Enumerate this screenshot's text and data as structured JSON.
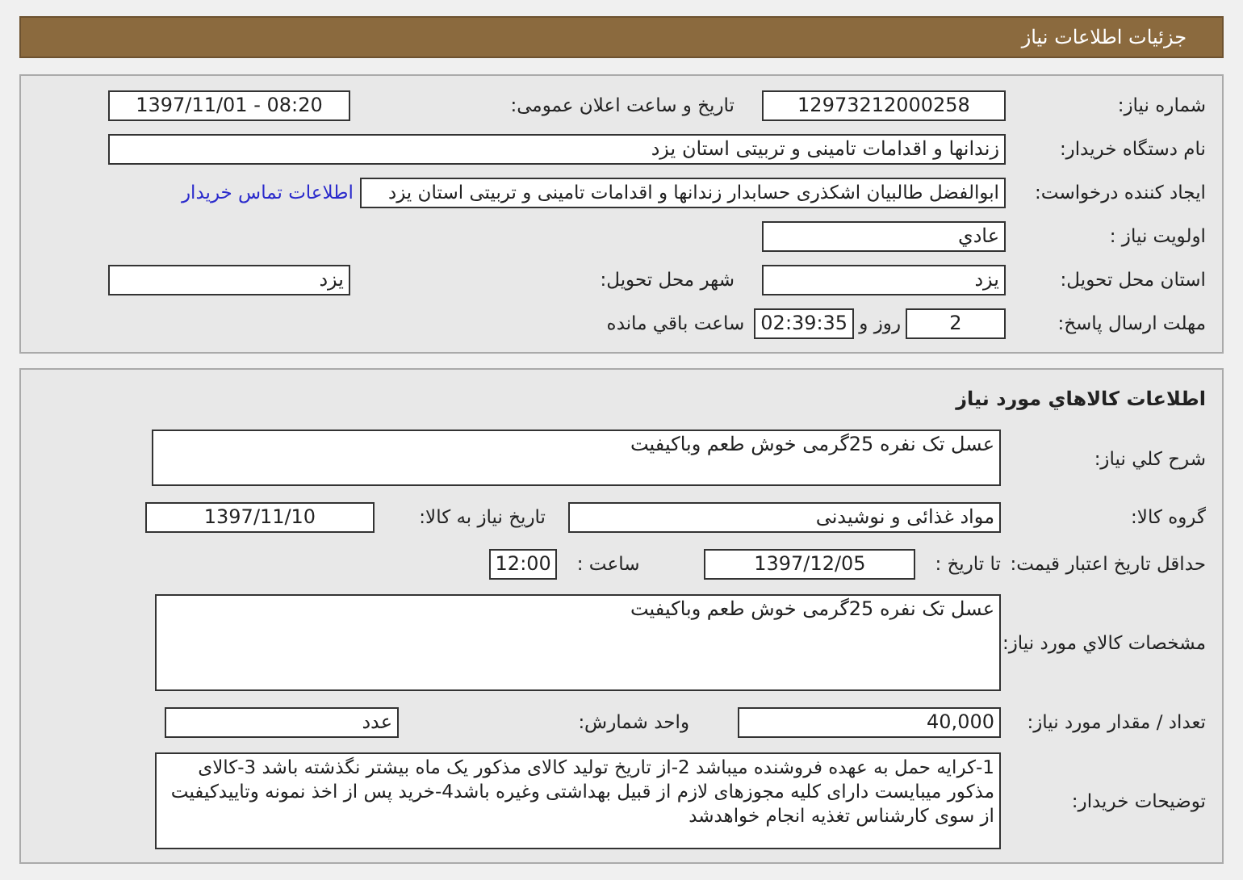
{
  "header": {
    "title": "جزئیات اطلاعات نیاز"
  },
  "need_info": {
    "need_number": {
      "label": "شماره نیاز:",
      "value": "12973212000258"
    },
    "announce": {
      "label": "تاریخ و ساعت اعلان عمومی:",
      "value": "1397/11/01 - 08:20"
    },
    "buyer_org": {
      "label": "نام دستگاه خریدار:",
      "value": "زندانها و اقدامات تامینی و تربیتی استان یزد"
    },
    "requester": {
      "label": "ایجاد کننده درخواست:",
      "value": "ابوالفضل  طالبیان اشکذری حسابدار زندانها و اقدامات تامینی و تربیتی استان یزد",
      "link": "اطلاعات تماس خریدار"
    },
    "priority": {
      "label": "اولویت نیاز :",
      "value": "عادي"
    },
    "province": {
      "label": "استان محل تحویل:",
      "value": "یزد"
    },
    "city": {
      "label": "شهر محل تحویل:",
      "value": "یزد"
    },
    "deadline": {
      "label": "مهلت ارسال پاسخ:",
      "days": "2",
      "days_unit": "روز و",
      "time": "02:39:35",
      "suffix": "ساعت باقي مانده"
    }
  },
  "goods": {
    "title": "اطلاعات کالاهاي مورد نياز",
    "description": {
      "label": "شرح کلي نیاز:",
      "value": "عسل تک نفره 25گرمی خوش طعم وباکیفیت"
    },
    "group": {
      "label": "گروه کالا:",
      "value": "مواد غذائی و نوشیدنی"
    },
    "need_date": {
      "label": "تاریخ نیاز به کالا:",
      "value": "1397/11/10"
    },
    "validity": {
      "label": "حداقل تاریخ اعتبار قیمت:",
      "to_label": "تا تاریخ :",
      "date": "1397/12/05",
      "time_label": "ساعت :",
      "time": "12:00"
    },
    "specs": {
      "label": "مشخصات کالاي مورد نياز:",
      "value": "عسل تک نفره 25گرمی خوش طعم وباکیفیت"
    },
    "quantity": {
      "label": "تعداد / مقدار مورد نیاز:",
      "value": "40,000"
    },
    "unit": {
      "label": "واحد شمارش:",
      "value": "عدد"
    },
    "notes": {
      "label": "توضیحات خریدار:",
      "value": "1-کرایه حمل به عهده فروشنده میباشد 2-از تاریخ تولید کالای مذکور یک ماه بیشتر نگذشته باشد 3-کالای مذکور میبایست دارای کلیه مجوزهای لازم از قبیل بهداشتی وغیره باشد4-خرید پس از اخذ نمونه وتاییدکیفیت از سوی کارشناس تغذیه انجام خواهدشد"
    }
  }
}
